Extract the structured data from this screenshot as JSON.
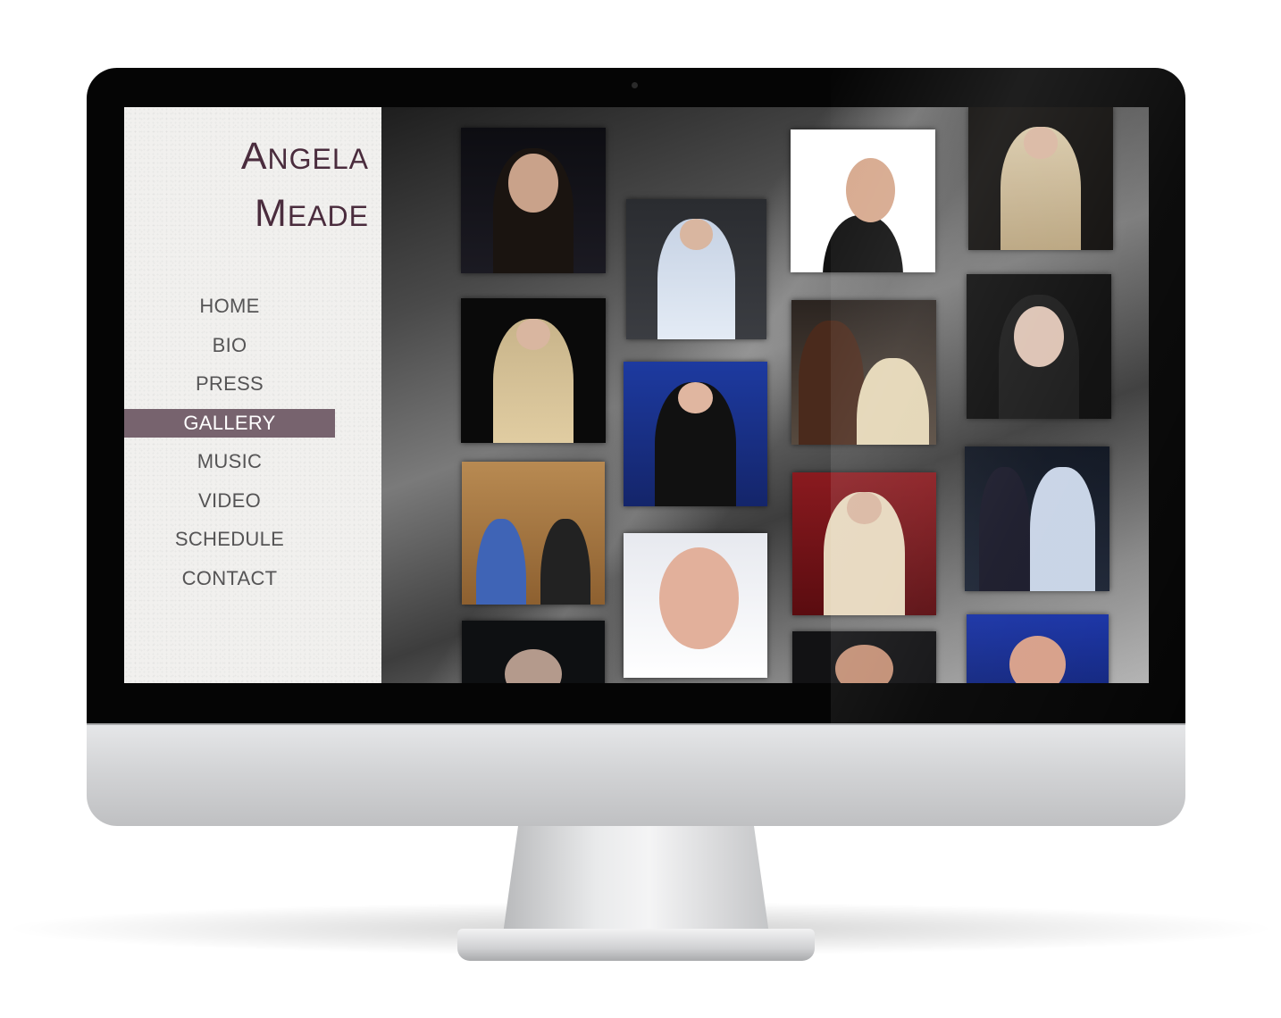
{
  "site": {
    "logo_line1": "Angela",
    "logo_line2": "Meade"
  },
  "nav": {
    "items": [
      {
        "label": "HOME"
      },
      {
        "label": "BIO"
      },
      {
        "label": "PRESS"
      },
      {
        "label": "GALLERY",
        "active": true
      },
      {
        "label": "MUSIC"
      },
      {
        "label": "VIDEO"
      },
      {
        "label": "SCHEDULE"
      },
      {
        "label": "CONTACT"
      }
    ]
  },
  "colors": {
    "accent": "#77636e",
    "logo": "#4a2c3d",
    "nav_text": "#555455"
  },
  "gallery": {
    "photo_count": 16
  }
}
